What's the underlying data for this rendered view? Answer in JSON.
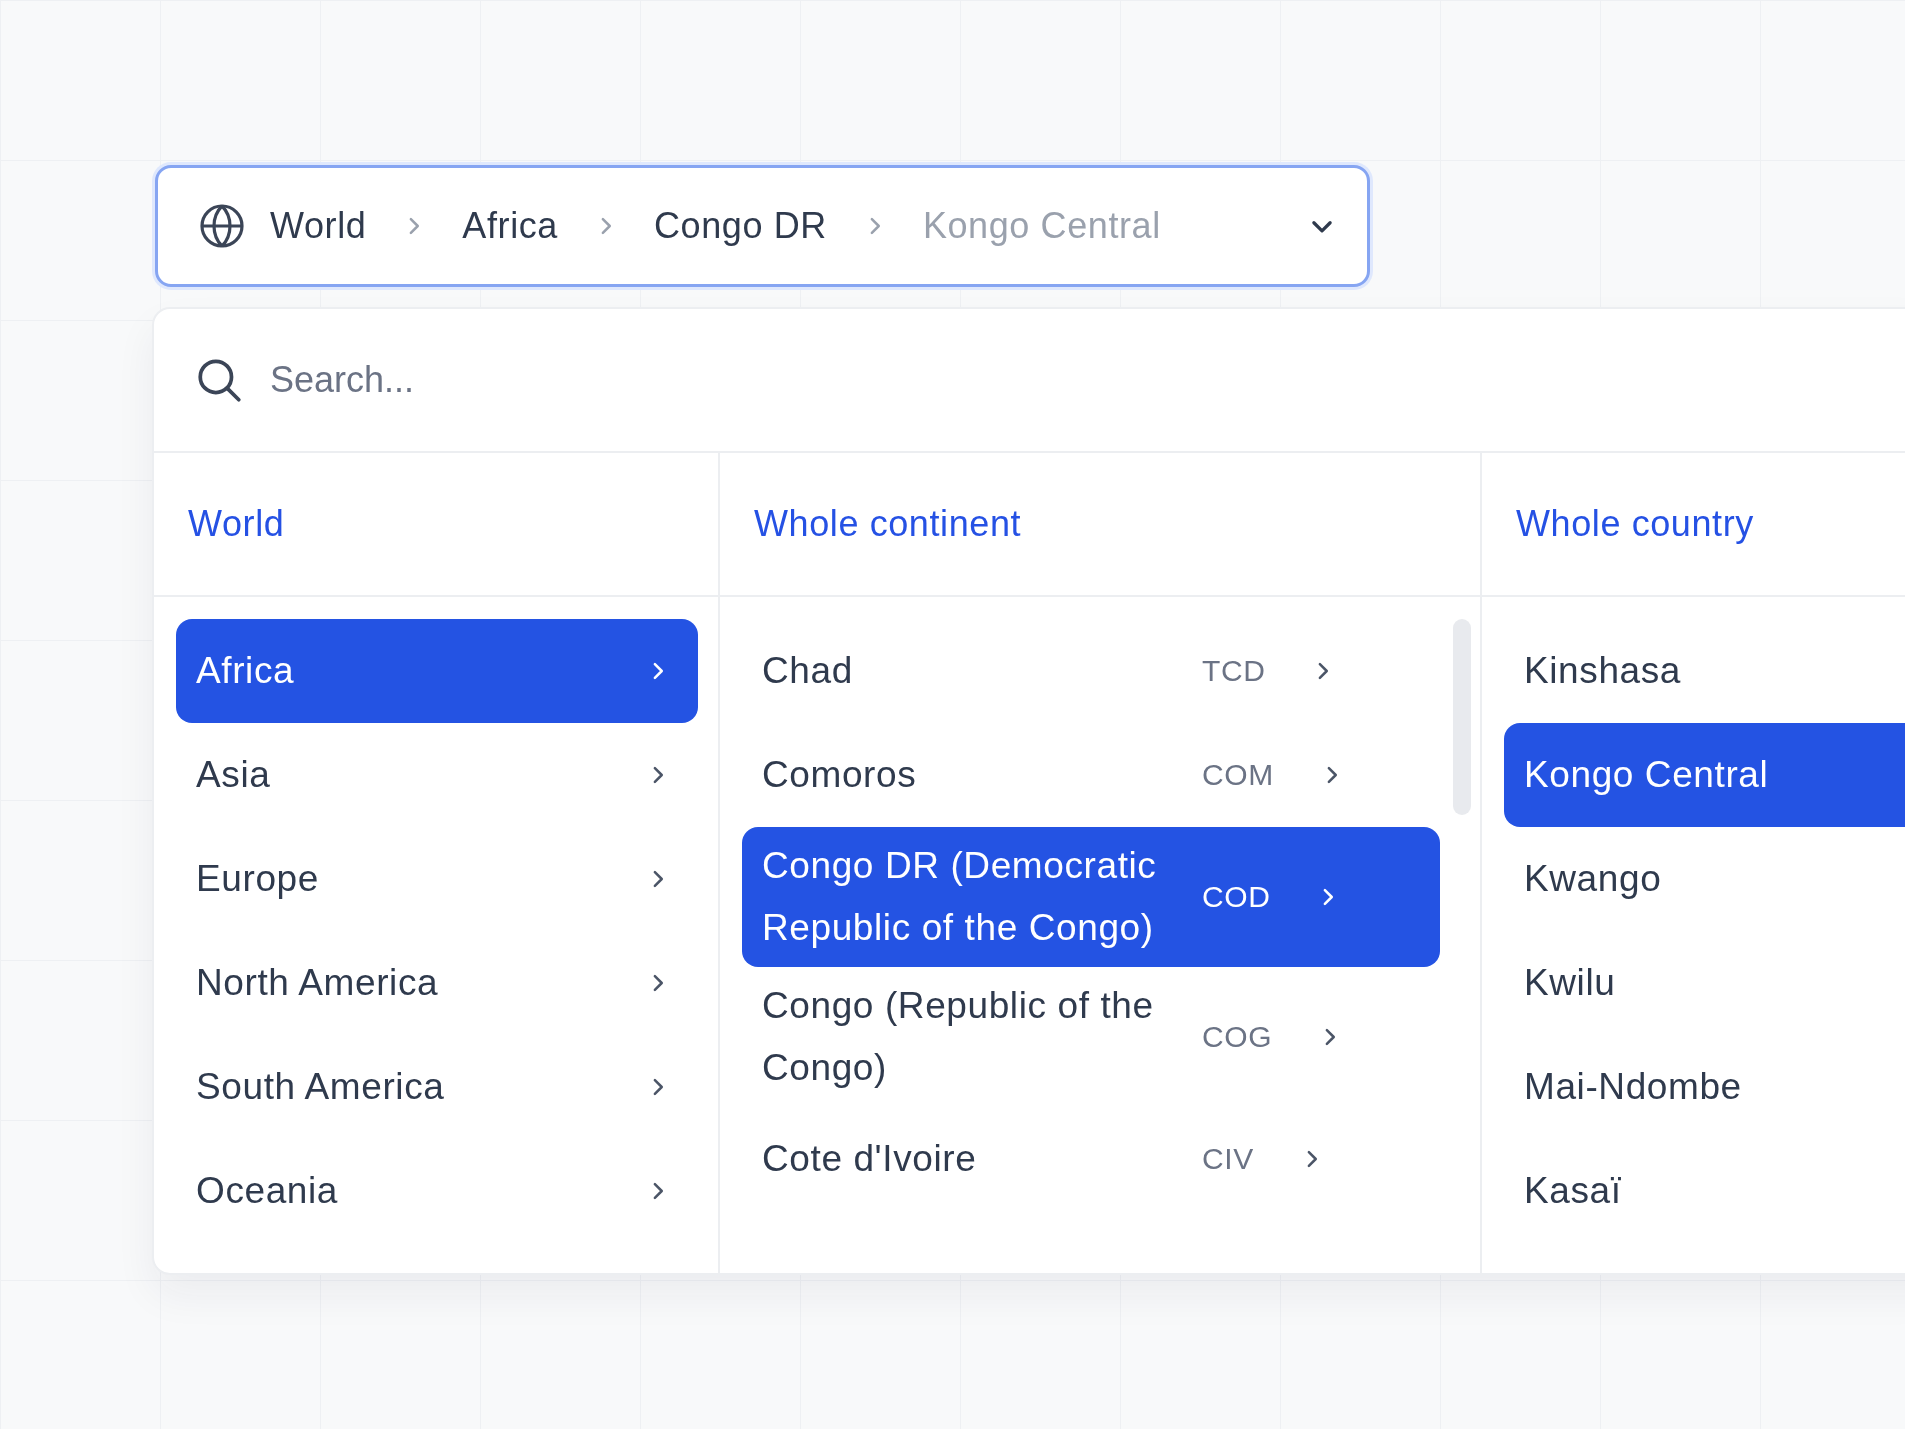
{
  "breadcrumb": {
    "items": [
      {
        "label": "World",
        "current": false
      },
      {
        "label": "Africa",
        "current": false
      },
      {
        "label": "Congo DR",
        "current": false
      },
      {
        "label": "Kongo Central",
        "current": true
      }
    ]
  },
  "search": {
    "placeholder": "Search..."
  },
  "columns": [
    {
      "header": "World",
      "items": [
        {
          "label": "Africa",
          "has_children": true,
          "selected": true
        },
        {
          "label": "Asia",
          "has_children": true,
          "selected": false
        },
        {
          "label": "Europe",
          "has_children": true,
          "selected": false
        },
        {
          "label": "North America",
          "has_children": true,
          "selected": false
        },
        {
          "label": "South America",
          "has_children": true,
          "selected": false
        },
        {
          "label": "Oceania",
          "has_children": true,
          "selected": false
        }
      ]
    },
    {
      "header": "Whole continent",
      "items": [
        {
          "label": "Chad",
          "code": "TCD",
          "has_children": true,
          "selected": false
        },
        {
          "label": "Comoros",
          "code": "COM",
          "has_children": true,
          "selected": false
        },
        {
          "label": "Congo DR (Democratic Republic of the Congo)",
          "code": "COD",
          "has_children": true,
          "selected": true
        },
        {
          "label": "Congo (Republic of the Congo)",
          "code": "COG",
          "has_children": true,
          "selected": false
        },
        {
          "label": "Cote d'Ivoire",
          "code": "CIV",
          "has_children": true,
          "selected": false
        }
      ]
    },
    {
      "header": "Whole country",
      "items": [
        {
          "label": "Kinshasa",
          "has_children": false,
          "selected": false
        },
        {
          "label": "Kongo Central",
          "has_children": false,
          "selected": true
        },
        {
          "label": "Kwango",
          "has_children": false,
          "selected": false
        },
        {
          "label": "Kwilu",
          "has_children": false,
          "selected": false
        },
        {
          "label": "Mai-Ndombe",
          "has_children": false,
          "selected": false
        },
        {
          "label": "Kasaï",
          "has_children": false,
          "selected": false
        }
      ]
    }
  ]
}
